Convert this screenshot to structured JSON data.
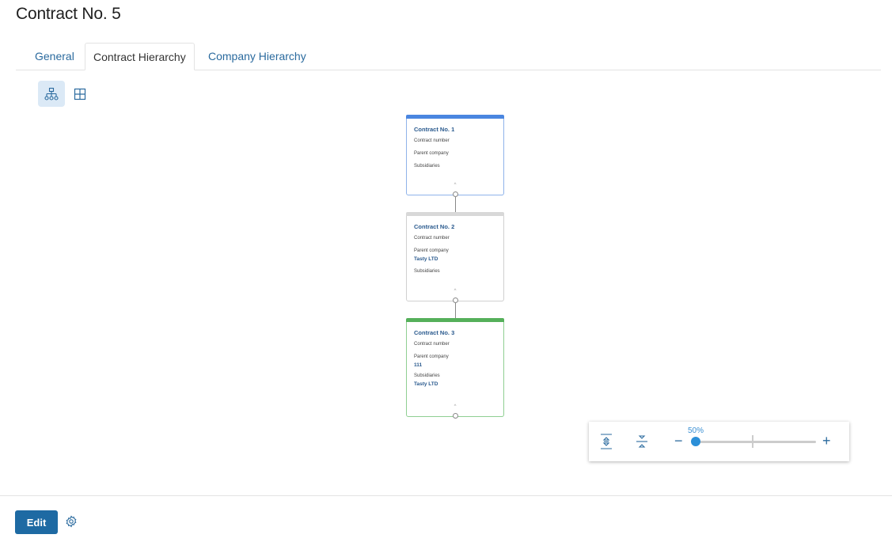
{
  "page": {
    "title": "Contract No. 5"
  },
  "tabs": [
    {
      "label": "General",
      "active": false
    },
    {
      "label": "Contract Hierarchy",
      "active": true
    },
    {
      "label": "Company Hierarchy",
      "active": false
    }
  ],
  "view_toggle": {
    "items": [
      {
        "icon": "hierarchy-tree-icon",
        "active": true
      },
      {
        "icon": "grid-table-icon",
        "active": false
      }
    ]
  },
  "cards": [
    {
      "title": "Contract No. 1",
      "accent": "#4a86e0",
      "border": "#8fb3ea",
      "fields": [
        {
          "label": "Contract number",
          "value": ""
        },
        {
          "label": "Parent company",
          "value": ""
        },
        {
          "label": "Subsidiaries",
          "value": ""
        }
      ]
    },
    {
      "title": "Contract No. 2",
      "accent": "#d8d8d8",
      "border": "#d0d0d0",
      "fields": [
        {
          "label": "Contract number",
          "value": ""
        },
        {
          "label": "Parent company",
          "value": "Tasty LTD"
        },
        {
          "label": "Subsidiaries",
          "value": ""
        }
      ]
    },
    {
      "title": "Contract No. 3",
      "accent": "#55b05a",
      "border": "#8fcf92",
      "fields": [
        {
          "label": "Contract number",
          "value": ""
        },
        {
          "label": "Parent company",
          "value": "111"
        },
        {
          "label": "Subsidiaries",
          "value": "Tasty LTD"
        }
      ]
    }
  ],
  "zoom_control": {
    "percent_label": "50%",
    "value_percent": 50,
    "minus": "−",
    "plus": "+"
  },
  "footer": {
    "edit_label": "Edit"
  },
  "colors": {
    "link": "#2a6a9e",
    "primary": "#1e6aa3",
    "accent_blue": "#2b8fd8"
  }
}
